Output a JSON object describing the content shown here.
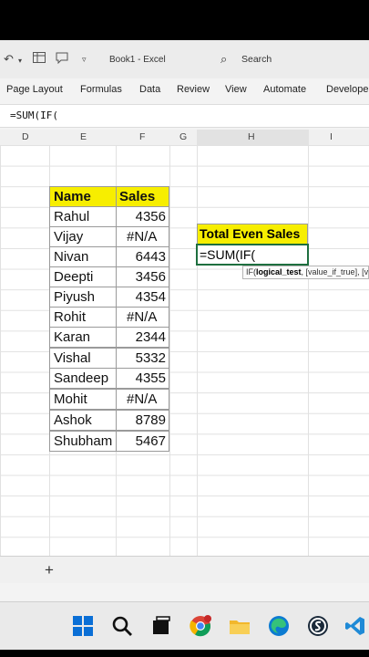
{
  "window": {
    "doc_title": "Book1  -  Excel",
    "search_label": "Search"
  },
  "ribbon_tabs": [
    "Page Layout",
    "Formulas",
    "Data",
    "Review",
    "View",
    "Automate",
    "Develope"
  ],
  "formula_bar": {
    "text": "=SUM(IF("
  },
  "columns": [
    "D",
    "E",
    "F",
    "G",
    "H",
    "I"
  ],
  "table": {
    "headers": {
      "name": "Name",
      "sales": "Sales"
    },
    "rows": [
      {
        "name": "Rahul",
        "sales": "4356"
      },
      {
        "name": "Vijay",
        "sales": "#N/A"
      },
      {
        "name": "Nivan",
        "sales": "6443"
      },
      {
        "name": "Deepti",
        "sales": "3456"
      },
      {
        "name": "Piyush",
        "sales": "4354"
      },
      {
        "name": "Rohit",
        "sales": "#N/A"
      },
      {
        "name": "Karan",
        "sales": "2344"
      },
      {
        "name": "Vishal",
        "sales": "5332"
      },
      {
        "name": "Sandeep",
        "sales": "4355"
      },
      {
        "name": "Mohit",
        "sales": "#N/A"
      },
      {
        "name": "Ashok",
        "sales": "8789"
      },
      {
        "name": "Shubham",
        "sales": "5467"
      }
    ]
  },
  "summary": {
    "label": "Total Even Sales",
    "formula": "=SUM(IF(",
    "tooltip_prefix": "IF(",
    "tooltip_bold": "logical_test",
    "tooltip_rest": ", [value_if_true], [value_if_false])"
  },
  "sheet": {
    "add_label": "+"
  },
  "colors": {
    "header_yellow": "#f7ee00",
    "excel_green": "#1e6f3f"
  }
}
